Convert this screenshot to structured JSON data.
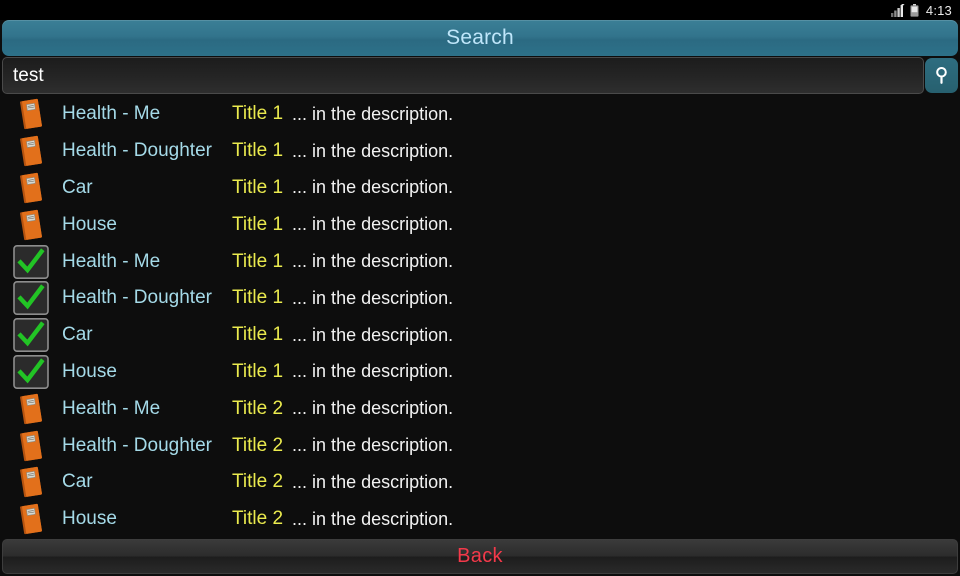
{
  "statusbar": {
    "signal_icon": "signal-bars-icon",
    "battery_icon": "battery-icon",
    "clock": "4:13"
  },
  "titlebar": {
    "title": "Search"
  },
  "search": {
    "value": "test",
    "placeholder": "",
    "button_icon": "search-magnifier-icon"
  },
  "colors": {
    "accent_header": "#32748c",
    "title_text": "#a5dae8",
    "subtitle_text": "#ebeb4e",
    "description_text": "#f2f2f2",
    "back_text": "#f4394a",
    "book_icon": "#e2701b",
    "check_icon": "#22c425"
  },
  "list": {
    "rows": [
      {
        "icon": "book-icon",
        "title": "Health - Me",
        "subtitle": "Title 1",
        "description": "... in the description."
      },
      {
        "icon": "book-icon",
        "title": "Health - Doughter",
        "subtitle": "Title 1",
        "description": "... in the description."
      },
      {
        "icon": "book-icon",
        "title": "Car",
        "subtitle": "Title 1",
        "description": "... in the description."
      },
      {
        "icon": "book-icon",
        "title": "House",
        "subtitle": "Title 1",
        "description": "... in the description."
      },
      {
        "icon": "check-icon",
        "title": "Health - Me",
        "subtitle": "Title 1",
        "description": "... in the description."
      },
      {
        "icon": "check-icon",
        "title": "Health - Doughter",
        "subtitle": "Title 1",
        "description": "... in the description."
      },
      {
        "icon": "check-icon",
        "title": "Car",
        "subtitle": "Title 1",
        "description": "... in the description."
      },
      {
        "icon": "check-icon",
        "title": "House",
        "subtitle": "Title 1",
        "description": "... in the description."
      },
      {
        "icon": "book-icon",
        "title": "Health - Me",
        "subtitle": "Title 2",
        "description": "... in the description."
      },
      {
        "icon": "book-icon",
        "title": "Health - Doughter",
        "subtitle": "Title 2",
        "description": "... in the description."
      },
      {
        "icon": "book-icon",
        "title": "Car",
        "subtitle": "Title 2",
        "description": "... in the description."
      },
      {
        "icon": "book-icon",
        "title": "House",
        "subtitle": "Title 2",
        "description": "... in the description."
      }
    ]
  },
  "footer": {
    "back_label": "Back"
  }
}
